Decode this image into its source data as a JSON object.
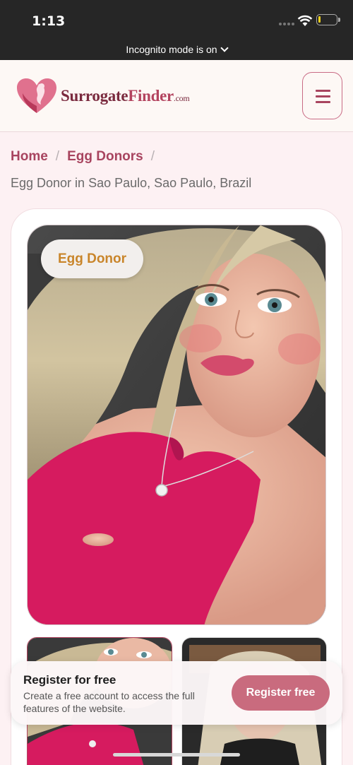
{
  "status": {
    "time": "1:13",
    "incognito": "Incognito mode is on"
  },
  "header": {
    "logo_part1": "Surrogate",
    "logo_part2": "Finder",
    "logo_part3": ".com"
  },
  "breadcrumb": {
    "items": [
      "Home",
      "Egg Donors"
    ],
    "separator": "/",
    "current": "Egg Donor in Sao Paulo, Sao Paulo, Brazil"
  },
  "profile": {
    "badge": "Egg Donor"
  },
  "register": {
    "title": "Register for free",
    "description": "Create a free account to access the full features of the website.",
    "button": "Register free"
  },
  "colors": {
    "accent": "#a8445f",
    "badge_text": "#c9852a",
    "register_button": "#c96b7e",
    "background": "#fdf1f3"
  },
  "icons": [
    "wifi-icon",
    "battery-icon",
    "chevron-down-icon",
    "heart-logo-icon",
    "hamburger-menu-icon"
  ]
}
